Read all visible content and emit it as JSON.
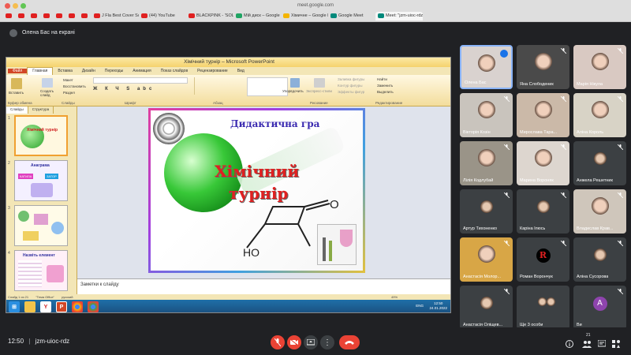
{
  "browser": {
    "url": "meet.google.com",
    "tabs": [
      {
        "label": "",
        "favicon": "youtube"
      },
      {
        "label": "",
        "favicon": "youtube"
      },
      {
        "label": "",
        "favicon": "youtube"
      },
      {
        "label": "",
        "favicon": "youtube"
      },
      {
        "label": "",
        "favicon": "youtube"
      },
      {
        "label": "",
        "favicon": "youtube"
      },
      {
        "label": "",
        "favicon": "youtube"
      },
      {
        "label": "J Fla Best Cover Songs 2020...",
        "favicon": "youtube"
      },
      {
        "label": "(44) YouTube",
        "favicon": "youtube"
      },
      {
        "label": "BLACKPINK - 'SOLO' + 'PPP'...",
        "favicon": "youtube"
      },
      {
        "label": "Мій диск – Google Диск",
        "favicon": "drive"
      },
      {
        "label": "Хімичне – Google Презента...",
        "favicon": "slides"
      },
      {
        "label": "Google Meet",
        "favicon": "meet"
      },
      {
        "label": "Meet: \"jzm-uioc-rdz\"",
        "favicon": "meet"
      }
    ]
  },
  "presenting_label": "Олена Бас на екрані",
  "ppt": {
    "title": "Хімічний турнір – Microsoft PowerPoint",
    "ribbon_tabs": [
      "Файл",
      "Главная",
      "Вставка",
      "Дизайн",
      "Переходы",
      "Анимация",
      "Показ слайдов",
      "Рецензирование",
      "Вид"
    ],
    "ribbon_groups": [
      "Буфер обмена",
      "Слайды",
      "Шрифт",
      "Абзац",
      "Рисование",
      "Редактирование"
    ],
    "ribbon_buttons": {
      "paste": "Вставить",
      "new_slide": "Создать слайд",
      "layout": "Макет",
      "reset": "Восстановить",
      "section": "Раздел",
      "arrange": "Упорядочить",
      "quick_styles": "Экспресс-стили",
      "shape_fill": "Заливка фигуры",
      "shape_outline": "Контур фигуры",
      "shape_effects": "Эффекты фигур",
      "find": "Найти",
      "replace": "Заменить",
      "select": "Выделить"
    },
    "pane_tabs": [
      "Слайды",
      "Структура"
    ],
    "thumbnails": [
      {
        "num": "1",
        "title": "Хімічний турнір"
      },
      {
        "num": "2",
        "title": "Анаграма",
        "labels": [
          "КАТИЛА",
          "ЗАТОР"
        ]
      },
      {
        "num": "3",
        "title": ""
      },
      {
        "num": "4",
        "title": "Назвіть елемент"
      }
    ],
    "slide": {
      "subtitle": "Дидактична гра",
      "title_line1": "Хімічний",
      "title_line2": "турнір",
      "label_o": "O",
      "label_ho": "HO"
    },
    "notes_placeholder": "Заметки к слайду",
    "status": {
      "slide": "Слайд 1 из 21",
      "theme": "\"Тема Office\"",
      "lang": "русский",
      "zoom": "49%"
    },
    "taskbar": {
      "lang": "ENG",
      "time": "12:50",
      "date": "24.01.2022"
    }
  },
  "participants": [
    {
      "name": "Олена Бас",
      "type": "photo",
      "bg": "#d9d2cf",
      "active": true
    },
    {
      "name": "Яна Слободеник",
      "type": "photo",
      "bg": "#4a4a4a"
    },
    {
      "name": "Марія Нікула",
      "type": "photo",
      "bg": "#d9c9c2"
    },
    {
      "name": "Вікторія Козін",
      "type": "photo",
      "bg": "#c9c4bd"
    },
    {
      "name": "Мирослава Тара...",
      "type": "photo",
      "bg": "#cbb9a8"
    },
    {
      "name": "Аліна Король",
      "type": "photo",
      "bg": "#d8d3c6"
    },
    {
      "name": "Лілія Кодлубай",
      "type": "photo",
      "bg": "#9a9488"
    },
    {
      "name": "Марина Вороняк",
      "type": "photo",
      "bg": "#ddd6cf"
    },
    {
      "name": "Анжела Решетник",
      "type": "photo",
      "bg": "#3c4043"
    },
    {
      "name": "Артур Тихоненко",
      "type": "photo",
      "bg": "#3c4043"
    },
    {
      "name": "Каріна Іпюсь",
      "type": "photo",
      "bg": "#3c4043"
    },
    {
      "name": "Владислав Крав...",
      "type": "photo",
      "bg": "#cfc6bb"
    },
    {
      "name": "Анастасія Молор...",
      "type": "photo",
      "bg": "#d8a646"
    },
    {
      "name": "Роман Ворончук",
      "type": "avatar-r",
      "bg": "#3c4043",
      "letter": "R"
    },
    {
      "name": "Аліна Сусорова",
      "type": "photo",
      "bg": "#3c4043"
    },
    {
      "name": "Анастасія Оліщев...",
      "type": "photo",
      "bg": "#3c4043"
    },
    {
      "name": "Ще 3 особи",
      "type": "group",
      "bg": "#3c4043"
    },
    {
      "name": "Ви",
      "type": "letter",
      "bg": "#3c4043",
      "letter": "A"
    }
  ],
  "bottom": {
    "time": "12:50",
    "meeting_code": "jzm-uioc-rdz",
    "participant_count": "21"
  },
  "colors": {
    "meet_bg": "#202124",
    "red": "#ea4335",
    "accent": "#8ab4f8"
  }
}
